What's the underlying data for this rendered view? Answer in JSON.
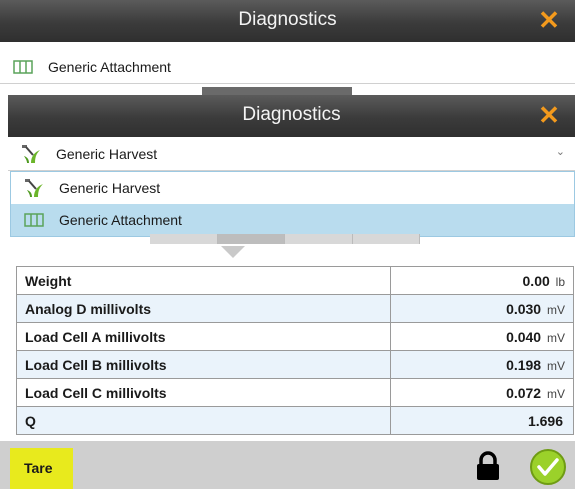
{
  "back_window": {
    "title": "Diagnostics",
    "close_glyph": "✕",
    "selected_item": "Generic Attachment",
    "selected_icon": "attachment-icon"
  },
  "front_window": {
    "title": "Diagnostics",
    "close_glyph": "✕",
    "selected_item": "Generic Harvest",
    "selected_icon": "harvest-icon",
    "chevron": "⌄",
    "options": [
      {
        "label": "Generic Harvest",
        "icon": "harvest-icon",
        "selected": false
      },
      {
        "label": "Generic Attachment",
        "icon": "attachment-icon",
        "selected": true
      }
    ]
  },
  "readings": [
    {
      "label": "Weight",
      "value": "0.00",
      "unit": "lb"
    },
    {
      "label": "Analog D millivolts",
      "value": "0.030",
      "unit": "mV"
    },
    {
      "label": "Load Cell A millivolts",
      "value": "0.040",
      "unit": "mV"
    },
    {
      "label": "Load Cell B millivolts",
      "value": "0.198",
      "unit": "mV"
    },
    {
      "label": "Load Cell C millivolts",
      "value": "0.072",
      "unit": "mV"
    },
    {
      "label": "Q",
      "value": "1.696",
      "unit": ""
    }
  ],
  "footer": {
    "tare_label": "Tare",
    "lock_icon": "lock-icon",
    "ok_icon": "check-circle-icon"
  },
  "colors": {
    "accent_close": "#f39a1d",
    "selection": "#b9dcee",
    "tare_button": "#e8ea1d",
    "ok_button": "#9bd12a"
  }
}
